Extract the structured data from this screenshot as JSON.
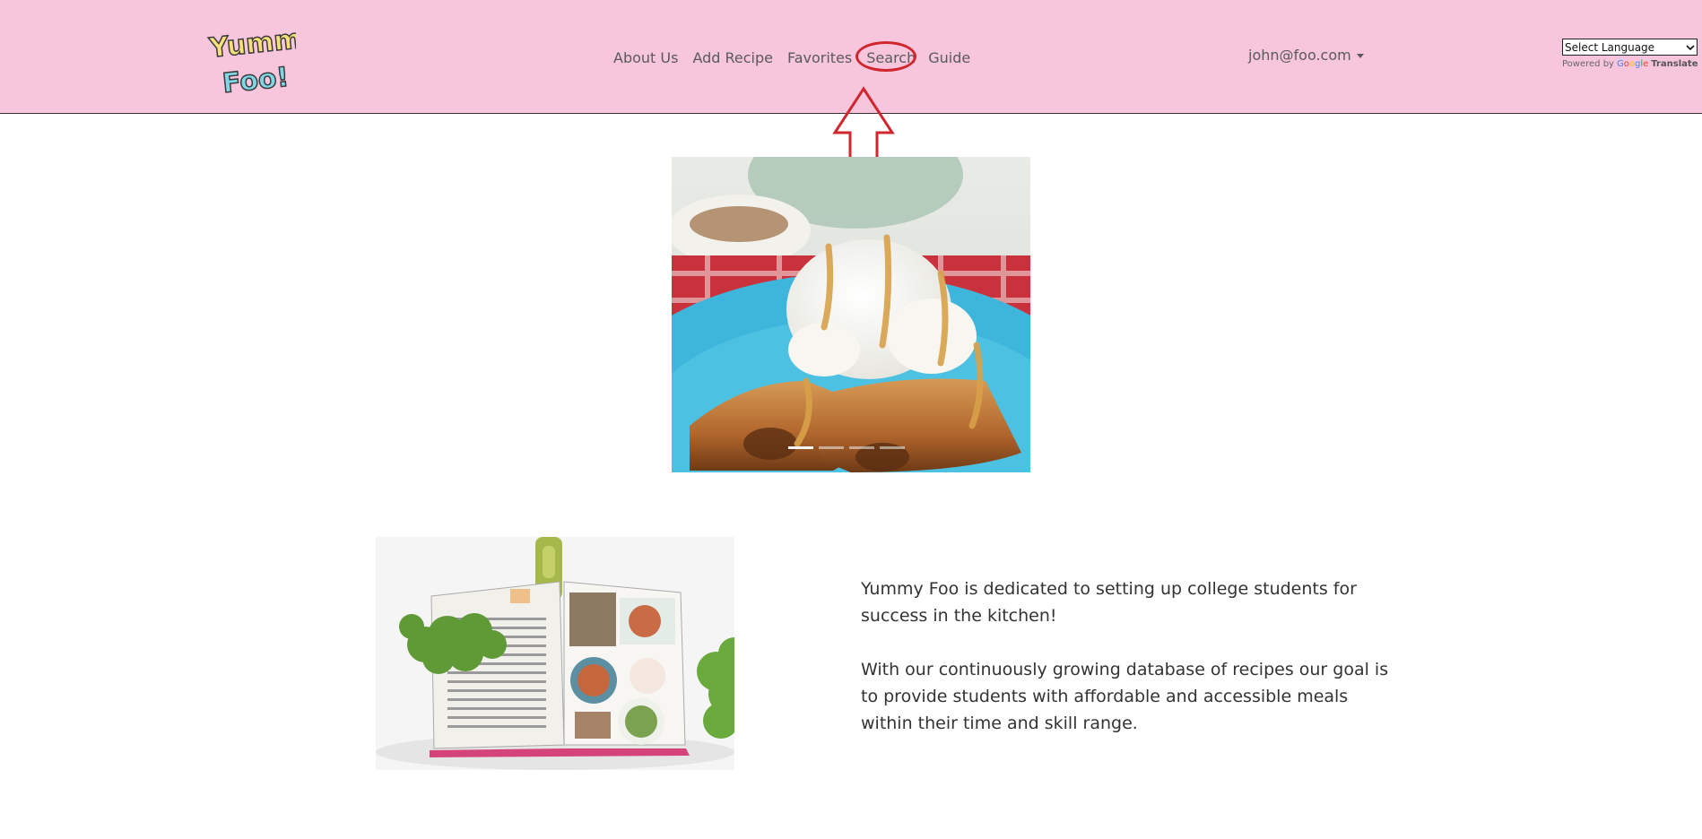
{
  "brand": {
    "logo_line1": "Yummy",
    "logo_line2": "Foo!"
  },
  "nav": {
    "items": [
      {
        "label": "About Us"
      },
      {
        "label": "Add Recipe"
      },
      {
        "label": "Favorites"
      },
      {
        "label": "Search"
      },
      {
        "label": "Guide"
      }
    ],
    "highlighted": "Search"
  },
  "user": {
    "email": "john@foo.com"
  },
  "translate": {
    "select_label": "Select Language",
    "powered_by": "Powered by",
    "google": "Google",
    "translate_label": "Translate"
  },
  "carousel": {
    "slide_count": 4,
    "active_index": 0
  },
  "about": {
    "paragraph1": "Yummy Foo is dedicated to setting up college students for success in the kitchen!",
    "paragraph2": "With our continuously growing database of recipes our goal is to provide students with affordable and accessible meals within their time and skill range."
  },
  "colors": {
    "navbar_bg": "#f7c6dd",
    "highlight": "#d0262e"
  }
}
